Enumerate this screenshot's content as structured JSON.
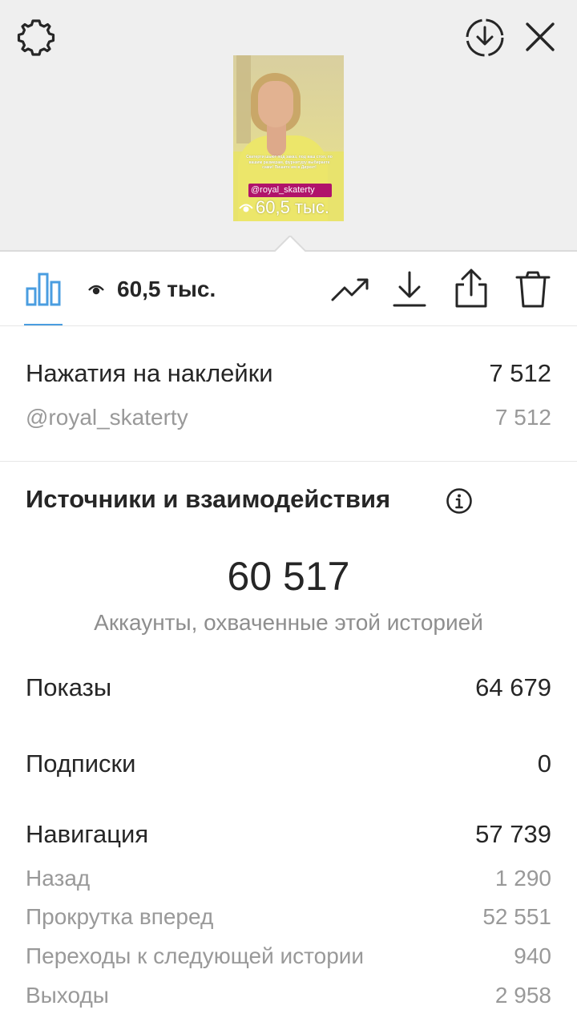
{
  "top_bar": {
    "settings_icon": "gear-icon",
    "download_icon": "download-circle-icon",
    "close_icon": "close-icon"
  },
  "story_thumbnail": {
    "caption": "Скатерти шьют под заказ, под ваш стол, по вашим размерам, фурнитуру выбираете сами! Пишите им в Директ!",
    "tag": "@royal_skaterty",
    "views": "60,5 тыс."
  },
  "toolbar": {
    "views_count": "60,5 тыс.",
    "accent_color": "#4a9de0",
    "icons": [
      "bar-chart-icon",
      "eye-icon",
      "trending-icon",
      "download-icon",
      "share-icon",
      "trash-icon"
    ]
  },
  "sticker_taps": {
    "label": "Нажатия на наклейки",
    "value": "7 512",
    "items": [
      {
        "label": "@royal_skaterty",
        "value": "7 512"
      }
    ]
  },
  "discovery": {
    "title": "Источники и взаимодействия",
    "reach_value": "60 517",
    "reach_label": "Аккаунты, охваченные этой историей",
    "impressions": {
      "label": "Показы",
      "value": "64 679"
    },
    "follows": {
      "label": "Подписки",
      "value": "0"
    },
    "navigation": {
      "label": "Навигация",
      "value": "57 739",
      "items": [
        {
          "label": "Назад",
          "value": "1 290"
        },
        {
          "label": "Прокрутка вперед",
          "value": "52 551"
        },
        {
          "label": "Переходы к следующей истории",
          "value": "940"
        },
        {
          "label": "Выходы",
          "value": "2 958"
        }
      ]
    }
  }
}
